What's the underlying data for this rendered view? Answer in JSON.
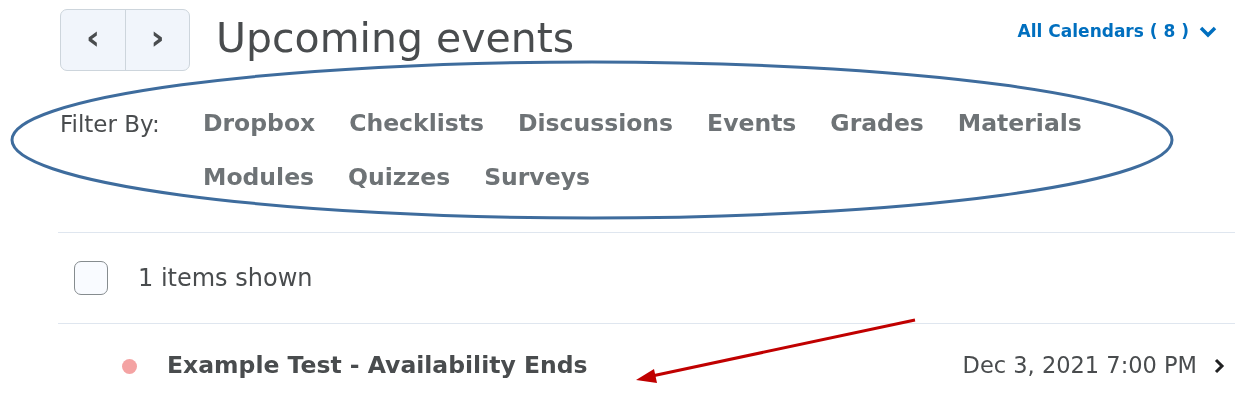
{
  "nav_buttons": [
    {
      "label": "‹"
    },
    {
      "label": "›"
    }
  ],
  "title": "Upcoming events",
  "calendar_menu": {
    "label": "All Calendars ( 8 )",
    "expanded": false
  },
  "filter": {
    "label": "Filter By:",
    "options": [
      [
        "Dropbox",
        "Checklists",
        "Discussions",
        "Events",
        "Grades",
        "Materials"
      ],
      [
        "Modules",
        "Quizzes",
        "Surveys"
      ]
    ]
  },
  "list_header": {
    "checked": false,
    "text": "1 items shown"
  },
  "events": [
    {
      "title": "Example Test - Availability Ends",
      "date": "Dec 3, 2021 7:00 PM",
      "color": "#f4a3a3"
    }
  ]
}
